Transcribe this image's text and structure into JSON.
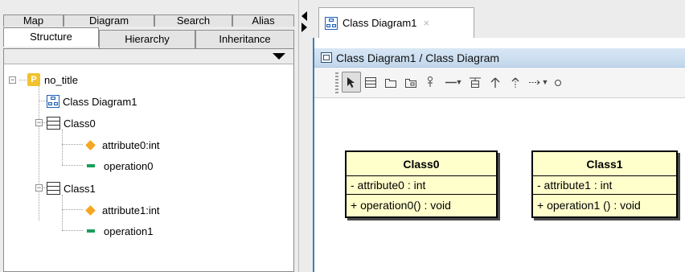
{
  "left_panel": {
    "tabs_row1": [
      {
        "label": "Map"
      },
      {
        "label": "Diagram"
      },
      {
        "label": "Search"
      },
      {
        "label": "Alias"
      }
    ],
    "tabs_row2": [
      {
        "label": "Structure",
        "active": true
      },
      {
        "label": "Hierarchy"
      },
      {
        "label": "Inheritance"
      }
    ],
    "tree": {
      "project": {
        "label": "no_title",
        "icon": "project-icon",
        "badge": "P"
      },
      "diagram": {
        "label": "Class Diagram1",
        "icon": "class-diagram-icon"
      },
      "classes": [
        {
          "label": "Class0",
          "icon": "class-icon",
          "attribute": "attribute0:int",
          "operation": "operation0"
        },
        {
          "label": "Class1",
          "icon": "class-icon",
          "attribute": "attribute1:int",
          "operation": "operation1"
        }
      ]
    }
  },
  "editor": {
    "tab_label": "Class Diagram1",
    "tab_close": "×",
    "header_title": "Class Diagram1 / Class Diagram",
    "toolbar_icons": [
      "select-arrow-icon",
      "class-icon",
      "package-icon",
      "subsystem-icon",
      "actor-icon",
      "association-icon",
      "dropdown-icon",
      "association-class-icon",
      "generalization-icon",
      "realization-icon",
      "dependency-icon",
      "dropdown-icon",
      "interface-icon"
    ]
  },
  "diagram": {
    "classes": [
      {
        "name": "Class0",
        "attribute": "- attribute0 : int",
        "operation": "+ operation0() : void"
      },
      {
        "name": "Class1",
        "attribute": "- attribute1 : int",
        "operation": "+ operation1 () : void"
      }
    ]
  },
  "colors": {
    "class_fill": "#ffffcc",
    "header_bg": "#c8dcf0",
    "attribute_icon": "#f5a623",
    "operation_icon": "#1a9e5a",
    "project_icon": "#f2c12e",
    "frame_accent": "#3c7fb1"
  }
}
